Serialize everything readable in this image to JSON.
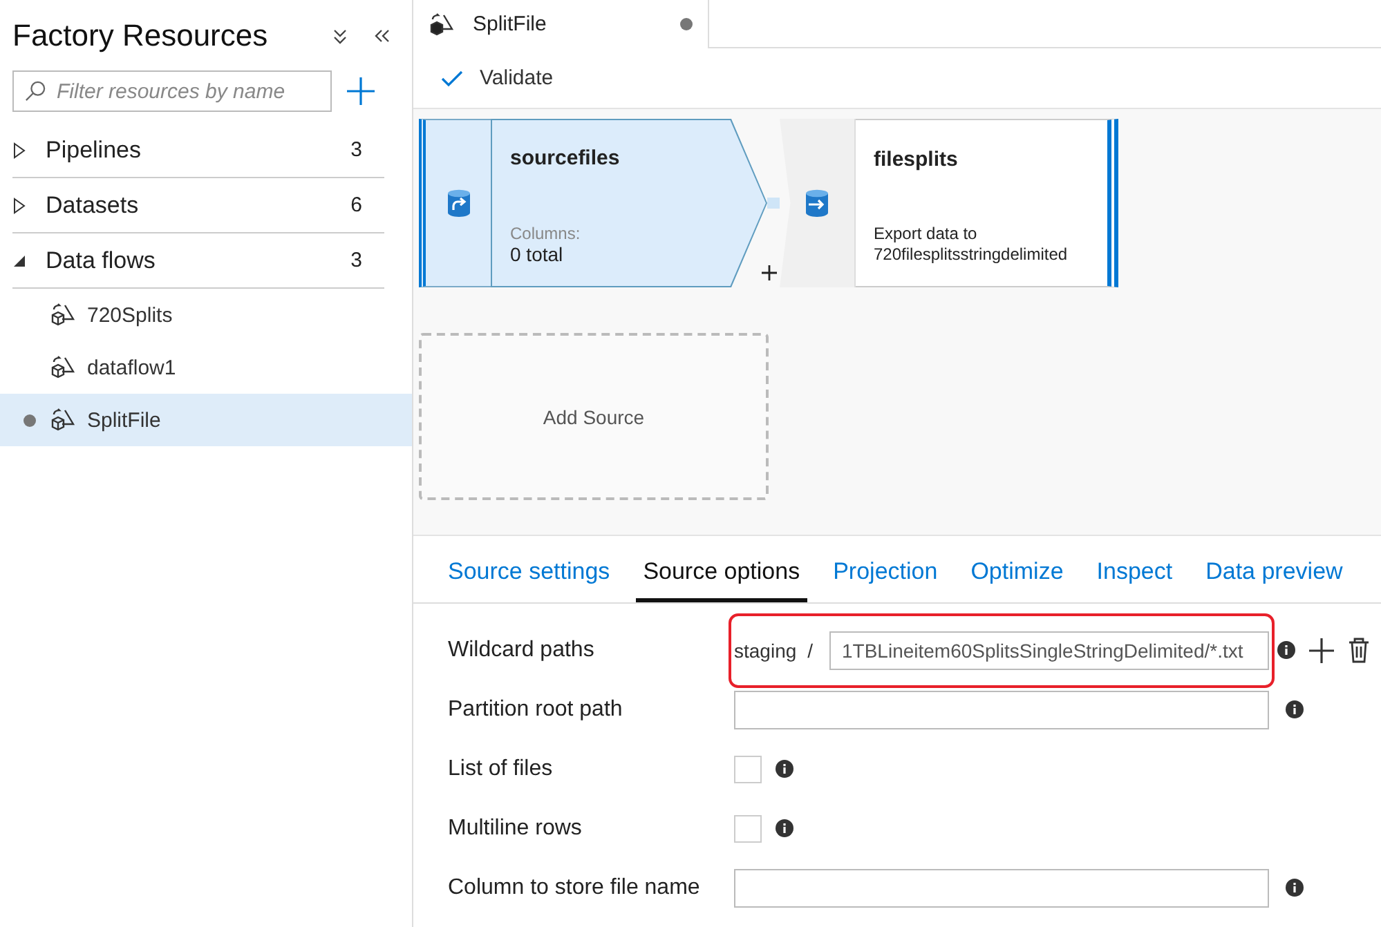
{
  "sidebar": {
    "title": "Factory Resources",
    "search": {
      "placeholder": "Filter resources by name"
    },
    "groups": [
      {
        "label": "Pipelines",
        "count": "3",
        "expanded": false
      },
      {
        "label": "Datasets",
        "count": "6",
        "expanded": false
      },
      {
        "label": "Data flows",
        "count": "3",
        "expanded": true,
        "children": [
          {
            "label": "720Splits",
            "selected": false,
            "unsaved": false
          },
          {
            "label": "dataflow1",
            "selected": false,
            "unsaved": false
          },
          {
            "label": "SplitFile",
            "selected": true,
            "unsaved": true
          }
        ]
      }
    ]
  },
  "editor_tabs": [
    {
      "label": "SplitFile",
      "selected": true,
      "unsaved": true
    }
  ],
  "toolbar": {
    "buttons": [
      "Validate"
    ]
  },
  "canvas": {
    "nodes": [
      {
        "kind": "source",
        "name": "sourcefiles",
        "caption": "Columns:",
        "detail": "0 total",
        "selected": true
      },
      {
        "kind": "sink",
        "name": "filesplits",
        "detail": "Export data to 720filesplitsstringdelimited",
        "selected": false
      }
    ],
    "add_source": "Add Source"
  },
  "panel": {
    "tabs": [
      {
        "label": "Source settings",
        "selected": false
      },
      {
        "label": "Source options",
        "selected": true
      },
      {
        "label": "Projection",
        "selected": false
      },
      {
        "label": "Optimize",
        "selected": false
      },
      {
        "label": "Inspect",
        "selected": false
      },
      {
        "label": "Data preview",
        "selected": false
      }
    ],
    "fields": [
      {
        "kind": "wildcard",
        "label": "Wildcard paths",
        "prefix": "staging",
        "separator": "/",
        "value": "1TBLineitem60SplitsSingleStringDelimited/*.txt",
        "highlighted": true
      },
      {
        "kind": "text",
        "label": "Partition root path"
      },
      {
        "kind": "checkbox",
        "label": "List of files",
        "checked": false
      },
      {
        "kind": "checkbox",
        "label": "Multiline rows",
        "checked": false
      },
      {
        "kind": "text",
        "label": "Column to store file name"
      }
    ]
  }
}
